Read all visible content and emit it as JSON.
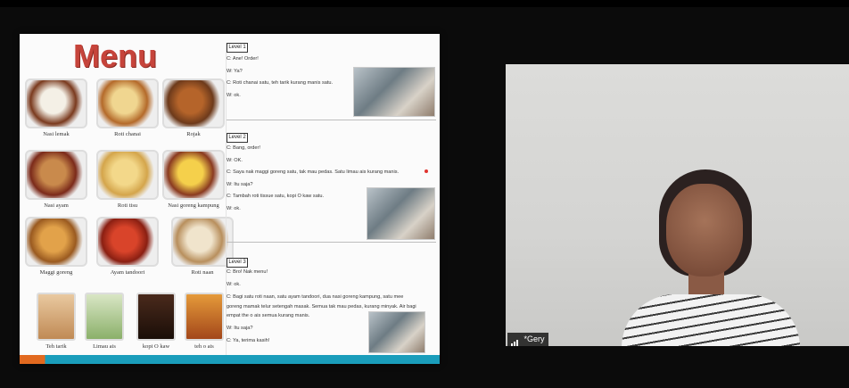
{
  "shared_screen": {
    "menu_title": "Menu",
    "menu_items": [
      {
        "label": "Nasi lemak"
      },
      {
        "label": "Roti chanai"
      },
      {
        "label": "Rojak"
      },
      {
        "label": "Nasi ayam"
      },
      {
        "label": "Roti tisu"
      },
      {
        "label": "Nasi goreng kampung"
      },
      {
        "label": "Maggi goreng"
      },
      {
        "label": "Ayam tandoori"
      },
      {
        "label": "Roti naan"
      },
      {
        "label": "Teh tarik"
      },
      {
        "label": "Limau ais"
      },
      {
        "label": "kopi O kaw"
      },
      {
        "label": "teh o ais"
      }
    ],
    "levels": [
      {
        "label": "Level 1",
        "lines": [
          "C: Ane! Order!",
          "W: Ya?",
          "C: Roti chanai satu, teh tarik kurang manis satu.",
          "W: ok."
        ]
      },
      {
        "label": "Level 2",
        "lines": [
          "C: Bang, order!",
          "W: OK.",
          "C: Saya nak maggi goreng satu, tak mau pedas. Satu limau ais kurang manis.",
          "W: Itu saja?",
          "C: Tambah roti tissue satu, kopi O kaw satu.",
          "W: ok."
        ]
      },
      {
        "label": "Level 3",
        "lines": [
          "C: Bro! Nak menu!",
          "W: ok.",
          "C: Bagi satu roti naan, satu ayam tandoori, dua nasi goreng kampung, satu mee",
          "goreng mamak telur setengah masak. Semua tak mau pedas, kurang minyak. Air bagi",
          "empat the o ais semua kurang manis.",
          "W: Itu saja?",
          "C: Ya, terima kasih!"
        ]
      }
    ]
  },
  "video": {
    "participant_name": "*Gery",
    "signal_icon": "signal-bars-icon"
  },
  "colors": {
    "menu_title": "#c6443b",
    "bottom_bar_accent": "#1a9dbb",
    "bottom_bar_orange": "#e2691f"
  }
}
